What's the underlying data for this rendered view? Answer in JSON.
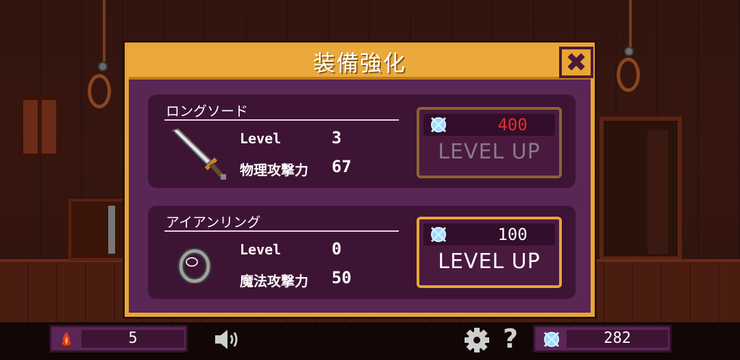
{
  "dialog": {
    "title": "装備強化",
    "close_icon": "close-x-icon",
    "colors": {
      "frame": "#e8a636",
      "panel": "#5a2656",
      "card": "#3e1434"
    }
  },
  "items": [
    {
      "name": "ロングソード",
      "icon": "long-sword-icon",
      "level_label": "Level",
      "level": "3",
      "stat_label": "物理攻撃力",
      "stat_value": "67",
      "cost": "400",
      "cost_color": "#e03030",
      "button_label": "LEVEL UP",
      "button_enabled": false
    },
    {
      "name": "アイアンリング",
      "icon": "iron-ring-icon",
      "level_label": "Level",
      "level": "0",
      "stat_label": "魔法攻撃力",
      "stat_value": "50",
      "cost": "100",
      "cost_color": "#ffffff",
      "button_label": "LEVEL UP",
      "button_enabled": true
    }
  ],
  "hud": {
    "campfire_count": "5",
    "campfire_icon": "campfire-icon",
    "sound_icon": "speaker-icon",
    "settings_icon": "gear-icon",
    "help_icon": "question-icon",
    "soul_count": "282",
    "soul_icon": "soul-gem-icon"
  }
}
